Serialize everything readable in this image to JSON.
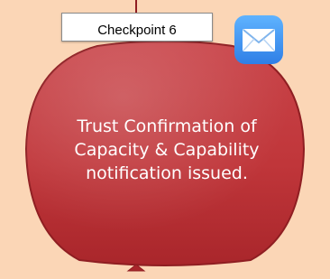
{
  "checkpoint": {
    "label": "Checkpoint 6"
  },
  "node": {
    "text_lines": [
      "Trust Confirmation of",
      "Capacity & Capability",
      "notification issued."
    ]
  },
  "icons": {
    "mail": "envelope-mail-icon"
  },
  "colors": {
    "background": "#fbd6b6",
    "node_fill": "#c0363a",
    "node_stroke": "#8f1e22",
    "text": "#ffffff",
    "mail_icon_blue": "#3a8ff0"
  }
}
